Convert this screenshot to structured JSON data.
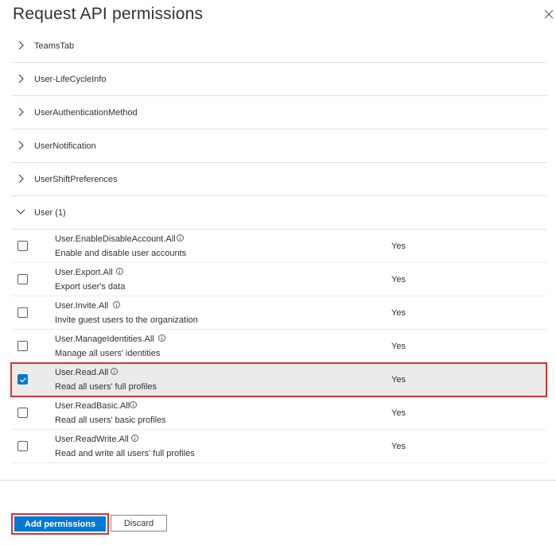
{
  "panel": {
    "title": "Request API permissions"
  },
  "groups": [
    {
      "label": "TeamsTab",
      "expanded": false
    },
    {
      "label": "User-LifeCycleInfo",
      "expanded": false
    },
    {
      "label": "UserAuthenticationMethod",
      "expanded": false
    },
    {
      "label": "UserNotification",
      "expanded": false
    },
    {
      "label": "UserShiftPreferences",
      "expanded": false
    },
    {
      "label": "User (1)",
      "expanded": true
    }
  ],
  "permissions": [
    {
      "name": "User.EnableDisableAccount.All",
      "description": "Enable and disable user accounts",
      "admin_consent": "Yes",
      "checked": false
    },
    {
      "name": "User.Export.All",
      "description": "Export user's data",
      "admin_consent": "Yes",
      "checked": false
    },
    {
      "name": "User.Invite.All",
      "description": "Invite guest users to the organization",
      "admin_consent": "Yes",
      "checked": false
    },
    {
      "name": "User.ManageIdentities.All",
      "description": "Manage all users' identities",
      "admin_consent": "Yes",
      "checked": false
    },
    {
      "name": "User.Read.All",
      "description": "Read all users' full profiles",
      "admin_consent": "Yes",
      "checked": true
    },
    {
      "name": "User.ReadBasic.All",
      "description": "Read all users' basic profiles",
      "admin_consent": "Yes",
      "checked": false
    },
    {
      "name": "User.ReadWrite.All",
      "description": "Read and write all users' full profiles",
      "admin_consent": "Yes",
      "checked": false
    }
  ],
  "footer": {
    "add_label": "Add permissions",
    "discard_label": "Discard"
  },
  "colors": {
    "accent": "#0078d4",
    "highlight": "#d13438",
    "selected_row": "#edebe9"
  }
}
